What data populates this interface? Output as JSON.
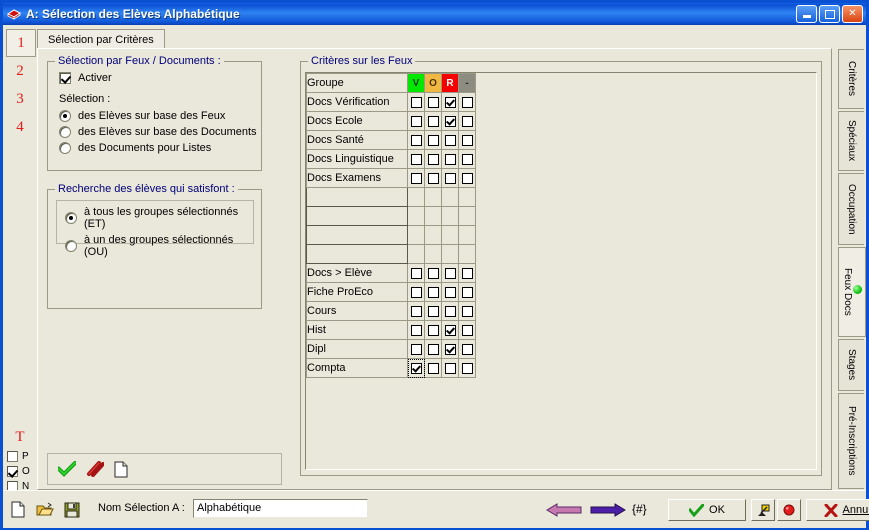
{
  "window": {
    "title": "A: Sélection des Elèves Alphabétique",
    "icon": "window-app-icon",
    "buttons": {
      "minimize": "minimize-icon",
      "maximize": "maximize-icon",
      "close": "close-icon"
    }
  },
  "left_strip": {
    "numbers": [
      "1",
      "2",
      "3",
      "4"
    ],
    "selected": "1",
    "t_label": "T",
    "toggles": [
      {
        "label": "P",
        "checked": false
      },
      {
        "label": "O",
        "checked": true
      },
      {
        "label": "N",
        "checked": false
      }
    ]
  },
  "tabs": {
    "main": "Sélection par Critères"
  },
  "selection_group": {
    "legend": "Sélection par Feux / Documents :",
    "activer": {
      "label": "Activer",
      "checked": true
    },
    "selection_label": "Sélection :",
    "options": [
      {
        "label": "des Elèves sur base des Feux",
        "selected": true
      },
      {
        "label": "des Elèves sur base des Documents",
        "selected": false
      },
      {
        "label": "des Documents pour Listes",
        "selected": false
      }
    ]
  },
  "search_group": {
    "legend": "Recherche des élèves qui satisfont :",
    "options": [
      {
        "label": "à tous les groupes sélectionnés (ET)",
        "selected": true
      },
      {
        "label": "à un des groupes sélectionnés (OU)",
        "selected": false
      }
    ]
  },
  "icon_bar": {
    "icons": [
      "green-check-icon",
      "red-strike-icon",
      "blank-page-icon"
    ]
  },
  "criteria_group": {
    "legend": "Critères sur les Feux",
    "columns": [
      {
        "key": "name",
        "label": "Groupe"
      },
      {
        "key": "v",
        "label": "V",
        "color": "#00E800"
      },
      {
        "key": "o",
        "label": "O",
        "color": "#F0B840"
      },
      {
        "key": "r",
        "label": "R",
        "color": "#F40000"
      },
      {
        "key": "g",
        "label": "-",
        "color": "#8C8C80"
      }
    ],
    "rows": [
      {
        "name": "Docs Vérification",
        "cells": [
          false,
          false,
          true,
          false
        ],
        "has_cells": true
      },
      {
        "name": "Docs Ecole",
        "cells": [
          false,
          false,
          true,
          false
        ],
        "has_cells": true
      },
      {
        "name": "Docs Santé",
        "cells": [
          false,
          false,
          false,
          false
        ],
        "has_cells": true
      },
      {
        "name": "Docs Linguistique",
        "cells": [
          false,
          false,
          false,
          false
        ],
        "has_cells": true
      },
      {
        "name": "Docs Examens",
        "cells": [
          false,
          false,
          false,
          false
        ],
        "has_cells": true
      },
      {
        "name": "",
        "cells": [],
        "has_cells": false
      },
      {
        "name": "",
        "cells": [],
        "has_cells": false
      },
      {
        "name": "",
        "cells": [],
        "has_cells": false
      },
      {
        "name": "",
        "cells": [],
        "has_cells": false
      },
      {
        "name": "Docs > Elève",
        "cells": [
          false,
          false,
          false,
          false
        ],
        "has_cells": true
      },
      {
        "name": "Fiche ProEco",
        "cells": [
          false,
          false,
          false,
          false
        ],
        "has_cells": true
      },
      {
        "name": "Cours",
        "cells": [
          false,
          false,
          false,
          false
        ],
        "has_cells": true
      },
      {
        "name": "Hist",
        "cells": [
          false,
          false,
          true,
          false
        ],
        "has_cells": true
      },
      {
        "name": "Dipl",
        "cells": [
          false,
          false,
          true,
          false
        ],
        "has_cells": true
      },
      {
        "name": "Compta",
        "cells": [
          true,
          false,
          false,
          false
        ],
        "has_cells": true,
        "focus_cell": 0
      }
    ]
  },
  "vertical_tabs": [
    {
      "label": "Critères",
      "active": false
    },
    {
      "label": "Spéciaux",
      "active": false
    },
    {
      "label": "Occupation",
      "active": false
    },
    {
      "label": "Feux Docs",
      "active": true,
      "indicator": "green-dot-icon"
    },
    {
      "label": "Stages",
      "active": false
    },
    {
      "label": "Pré-Inscriptions",
      "active": false
    }
  ],
  "bottom_bar": {
    "file_icons": [
      "new-document-icon",
      "open-folder-icon",
      "save-disk-icon"
    ],
    "name_label": "Nom Sélection A :",
    "name_value": "Alphabétique",
    "name_placeholder": "",
    "prev_icon": "arrow-left-icon",
    "next_icon": "arrow-right-icon",
    "hash_label": "{#}",
    "ok_label": "OK",
    "tool_icon": "stamp-tool-icon",
    "red_icon": "red-ball-icon",
    "cancel_label": "Annuler"
  }
}
